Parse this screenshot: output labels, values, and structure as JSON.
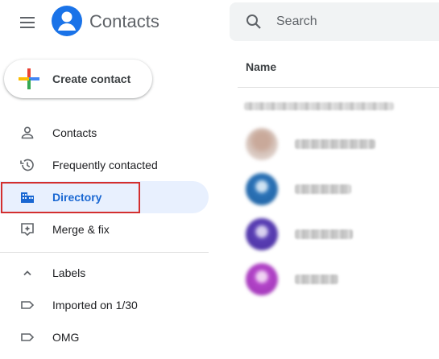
{
  "header": {
    "app_title": "Contacts",
    "search_placeholder": "Search"
  },
  "sidebar": {
    "create_label": "Create contact",
    "items": [
      {
        "label": "Contacts",
        "icon": "person-icon",
        "active": false
      },
      {
        "label": "Frequently contacted",
        "icon": "history-icon",
        "active": false
      },
      {
        "label": "Directory",
        "icon": "directory-icon",
        "active": true
      },
      {
        "label": "Merge & fix",
        "icon": "merge-fix-icon",
        "active": false
      }
    ],
    "labels_header": "Labels",
    "labels": [
      {
        "label": "Imported on 1/30",
        "icon": "label-icon"
      },
      {
        "label": "OMG",
        "icon": "label-icon"
      }
    ]
  },
  "main": {
    "column_header": "Name"
  },
  "colors": {
    "accent": "#1a73e8",
    "active_bg": "#e8f0fe",
    "active_text": "#1967d2",
    "highlight": "#d32f2f"
  }
}
